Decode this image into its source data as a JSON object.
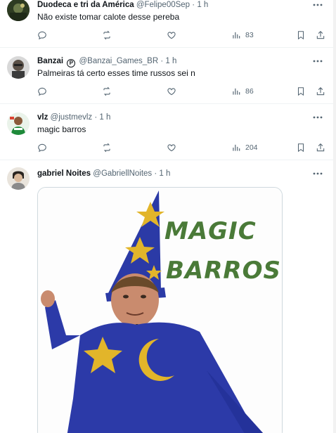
{
  "tweets": [
    {
      "name": "Duodeca e tri da América",
      "handle": "@Felipe00Sep",
      "sep": "·",
      "time": "1 h",
      "text": "Não existe tomar calote desse pereba",
      "views": "83"
    },
    {
      "name": "Banzai",
      "badge": "P",
      "handle": "@Banzai_Games_BR",
      "sep": "·",
      "time": "1 h",
      "text": "Palmeiras tá certo esses time russos sei n",
      "views": "86"
    },
    {
      "name": "vlz",
      "handle": "@justmevlz",
      "sep": "·",
      "time": "1 h",
      "text": "magic barros",
      "views": "204"
    },
    {
      "name": "gabriel Noites",
      "handle": "@GabriellNoites",
      "sep": "·",
      "time": "1 h",
      "media_line1": "MAGIC",
      "media_line2": "BARROS"
    }
  ],
  "colors": {
    "text": "#0f1419",
    "muted": "#536471",
    "divider": "#eff3f4",
    "robe": "#2c3aa8",
    "hat": "#2b3aa6",
    "star": "#e2b52a",
    "magic_green": "#4a7a38"
  },
  "icons": [
    "more-icon",
    "reply-icon",
    "retweet-icon",
    "like-icon",
    "views-icon",
    "bookmark-icon",
    "share-icon"
  ]
}
